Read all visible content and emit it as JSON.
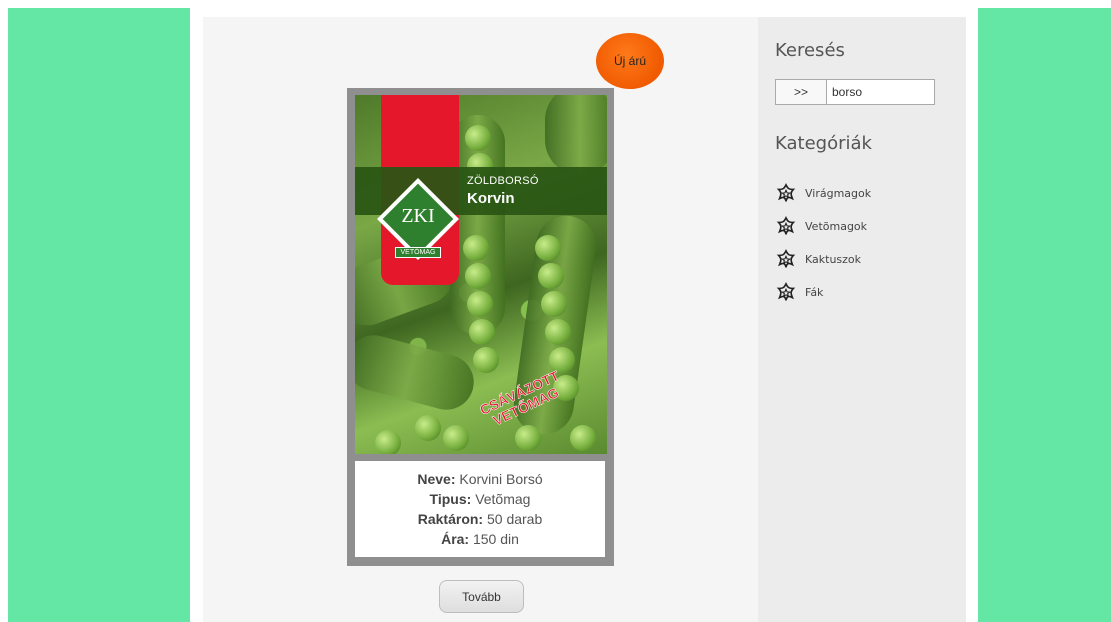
{
  "badge": {
    "label": "Új árú"
  },
  "product": {
    "image_band_subtitle": "ZÖLDBORSÓ",
    "image_band_title": "Korvin",
    "image_logo_text": "ZKI",
    "image_logo_strip": "VETŐMAG",
    "image_stamp_line1": "CSÁVÁZOTT",
    "image_stamp_line2": "VETŐMAG",
    "fields": [
      {
        "label": "Neve:",
        "value": "Korvini Borsó"
      },
      {
        "label": "Tipus:",
        "value": "Vetõmag"
      },
      {
        "label": "Raktáron:",
        "value": "50 darab"
      },
      {
        "label": "Ára:",
        "value": "150 din"
      }
    ],
    "more_button": "Tovább"
  },
  "sidebar": {
    "search_title": "Keresés",
    "search_button": ">>",
    "search_value": "borso",
    "categories_title": "Kategóriák",
    "categories": [
      {
        "label": "Virágmagok",
        "icon": "flower-star-icon"
      },
      {
        "label": "Vetõmagok",
        "icon": "flower-star-icon"
      },
      {
        "label": "Kaktuszok",
        "icon": "flower-star-icon"
      },
      {
        "label": "Fák",
        "icon": "flower-star-icon"
      }
    ]
  },
  "colors": {
    "side_green": "#64e6a4",
    "badge_orange": "#f05a00"
  }
}
